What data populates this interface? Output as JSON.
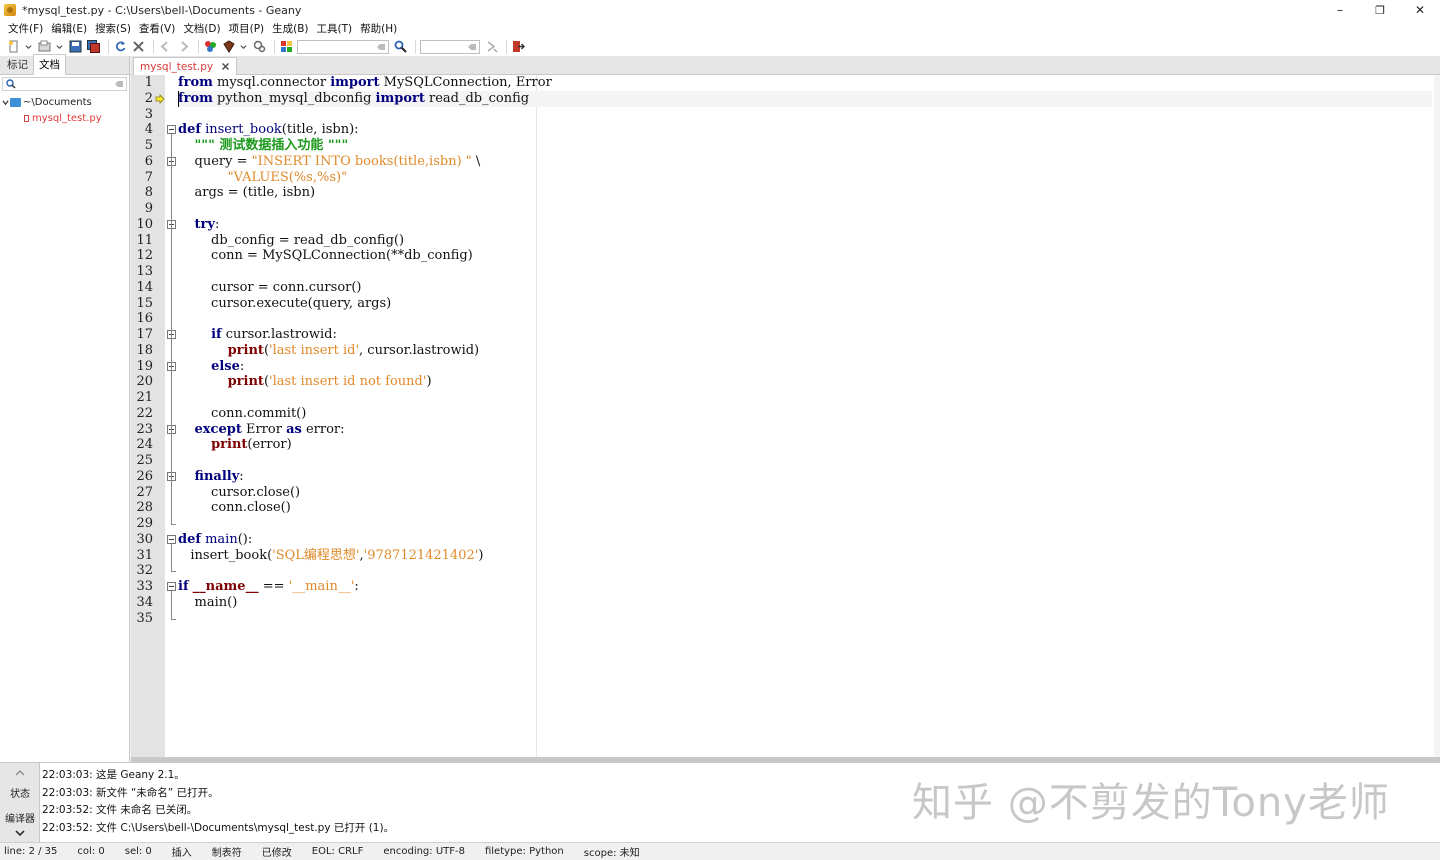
{
  "window": {
    "title": "*mysql_test.py - C:\\Users\\bell-\\Documents - Geany",
    "minimize": "–",
    "maximize": "❐",
    "close": "✕"
  },
  "menu": [
    "文件(F)",
    "编辑(E)",
    "搜索(S)",
    "查看(V)",
    "文档(D)",
    "项目(P)",
    "生成(B)",
    "工具(T)",
    "帮助(H)"
  ],
  "toolbar": {
    "search_value": "",
    "goto_value": ""
  },
  "sidebar": {
    "tabs": [
      "标记",
      "文档"
    ],
    "active_tab": 1,
    "search_value": "",
    "folder": "~\\Documents",
    "file": "mysql_test.py"
  },
  "editor": {
    "tab_label": "mysql_test.py",
    "current_line": 2,
    "line_numbers": [
      "1",
      "2",
      "3",
      "4",
      "5",
      "6",
      "7",
      "8",
      "9",
      "10",
      "11",
      "12",
      "13",
      "14",
      "15",
      "16",
      "17",
      "18",
      "19",
      "20",
      "21",
      "22",
      "23",
      "24",
      "25",
      "26",
      "27",
      "28",
      "29",
      "30",
      "31",
      "32",
      "33",
      "34",
      "35"
    ],
    "lines": [
      [
        {
          "t": "from",
          "c": "kw"
        },
        {
          "t": " mysql.connector ",
          "c": ""
        },
        {
          "t": "import",
          "c": "kw"
        },
        {
          "t": " MySQLConnection, Error",
          "c": ""
        }
      ],
      [
        {
          "t": "from",
          "c": "kw"
        },
        {
          "t": " python_mysql_dbconfig ",
          "c": ""
        },
        {
          "t": "import",
          "c": "kw"
        },
        {
          "t": " read_db_config",
          "c": ""
        }
      ],
      [],
      [
        {
          "t": "def",
          "c": "kw"
        },
        {
          "t": " ",
          "c": ""
        },
        {
          "t": "insert_book",
          "c": "fn"
        },
        {
          "t": "(title, isbn):",
          "c": ""
        }
      ],
      [
        {
          "t": "    ",
          "c": ""
        },
        {
          "t": "\"\"\" 测试数据插入功能 \"\"\"",
          "c": "doc"
        }
      ],
      [
        {
          "t": "    query = ",
          "c": ""
        },
        {
          "t": "\"INSERT INTO books(title,isbn) \"",
          "c": "str"
        },
        {
          "t": " \\",
          "c": ""
        }
      ],
      [
        {
          "t": "            ",
          "c": ""
        },
        {
          "t": "\"VALUES(%s,%s)\"",
          "c": "str"
        }
      ],
      [
        {
          "t": "    args = (title, isbn)",
          "c": ""
        }
      ],
      [],
      [
        {
          "t": "    ",
          "c": ""
        },
        {
          "t": "try",
          "c": "kw"
        },
        {
          "t": ":",
          "c": ""
        }
      ],
      [
        {
          "t": "        db_config = read_db_config()",
          "c": ""
        }
      ],
      [
        {
          "t": "        conn = MySQLConnection(**db_config)",
          "c": ""
        }
      ],
      [],
      [
        {
          "t": "        cursor = conn.cursor()",
          "c": ""
        }
      ],
      [
        {
          "t": "        cursor.execute(query, args)",
          "c": ""
        }
      ],
      [],
      [
        {
          "t": "        ",
          "c": ""
        },
        {
          "t": "if",
          "c": "kw"
        },
        {
          "t": " cursor.lastrowid:",
          "c": ""
        }
      ],
      [
        {
          "t": "            ",
          "c": ""
        },
        {
          "t": "print",
          "c": "bi"
        },
        {
          "t": "(",
          "c": ""
        },
        {
          "t": "'last insert id'",
          "c": "str"
        },
        {
          "t": ", cursor.lastrowid)",
          "c": ""
        }
      ],
      [
        {
          "t": "        ",
          "c": ""
        },
        {
          "t": "else",
          "c": "kw"
        },
        {
          "t": ":",
          "c": ""
        }
      ],
      [
        {
          "t": "            ",
          "c": ""
        },
        {
          "t": "print",
          "c": "bi"
        },
        {
          "t": "(",
          "c": ""
        },
        {
          "t": "'last insert id not found'",
          "c": "str"
        },
        {
          "t": ")",
          "c": ""
        }
      ],
      [],
      [
        {
          "t": "        conn.commit()",
          "c": ""
        }
      ],
      [
        {
          "t": "    ",
          "c": ""
        },
        {
          "t": "except",
          "c": "kw"
        },
        {
          "t": " Error ",
          "c": ""
        },
        {
          "t": "as",
          "c": "kw"
        },
        {
          "t": " error:",
          "c": ""
        }
      ],
      [
        {
          "t": "        ",
          "c": ""
        },
        {
          "t": "print",
          "c": "bi"
        },
        {
          "t": "(error)",
          "c": ""
        }
      ],
      [],
      [
        {
          "t": "    ",
          "c": ""
        },
        {
          "t": "finally",
          "c": "kw"
        },
        {
          "t": ":",
          "c": ""
        }
      ],
      [
        {
          "t": "        cursor.close()",
          "c": ""
        }
      ],
      [
        {
          "t": "        conn.close()",
          "c": ""
        }
      ],
      [],
      [
        {
          "t": "def",
          "c": "kw"
        },
        {
          "t": " ",
          "c": ""
        },
        {
          "t": "main",
          "c": "fn"
        },
        {
          "t": "():",
          "c": ""
        }
      ],
      [
        {
          "t": "   insert_book(",
          "c": ""
        },
        {
          "t": "'SQL编程思想'",
          "c": "str"
        },
        {
          "t": ",",
          "c": ""
        },
        {
          "t": "'9787121421402'",
          "c": "str"
        },
        {
          "t": ")",
          "c": ""
        }
      ],
      [],
      [
        {
          "t": "if",
          "c": "kw"
        },
        {
          "t": " ",
          "c": ""
        },
        {
          "t": "__name__",
          "c": "dn"
        },
        {
          "t": " == ",
          "c": ""
        },
        {
          "t": "'__main__'",
          "c": "str"
        },
        {
          "t": ":",
          "c": ""
        }
      ],
      [
        {
          "t": "    main()",
          "c": ""
        }
      ],
      []
    ]
  },
  "messages": {
    "tabs": [
      "状态",
      "编译器"
    ],
    "lines": [
      "22:03:03: 这是 Geany 2.1。",
      "22:03:03: 新文件 “未命名” 已打开。",
      "22:03:52: 文件 未命名 已关闭。",
      "22:03:52: 文件 C:\\Users\\bell-\\Documents\\mysql_test.py 已打开 (1)。"
    ],
    "watermark": "知乎 @不剪发的Tony老师"
  },
  "status": {
    "line": "line: 2 / 35",
    "col": "col: 0",
    "sel": "sel: 0",
    "mode": "插入",
    "indent": "制表符",
    "modified": "已修改",
    "eol": "EOL: CRLF",
    "encoding": "encoding: UTF-8",
    "filetype": "filetype: Python",
    "scope": "scope: 未知"
  }
}
